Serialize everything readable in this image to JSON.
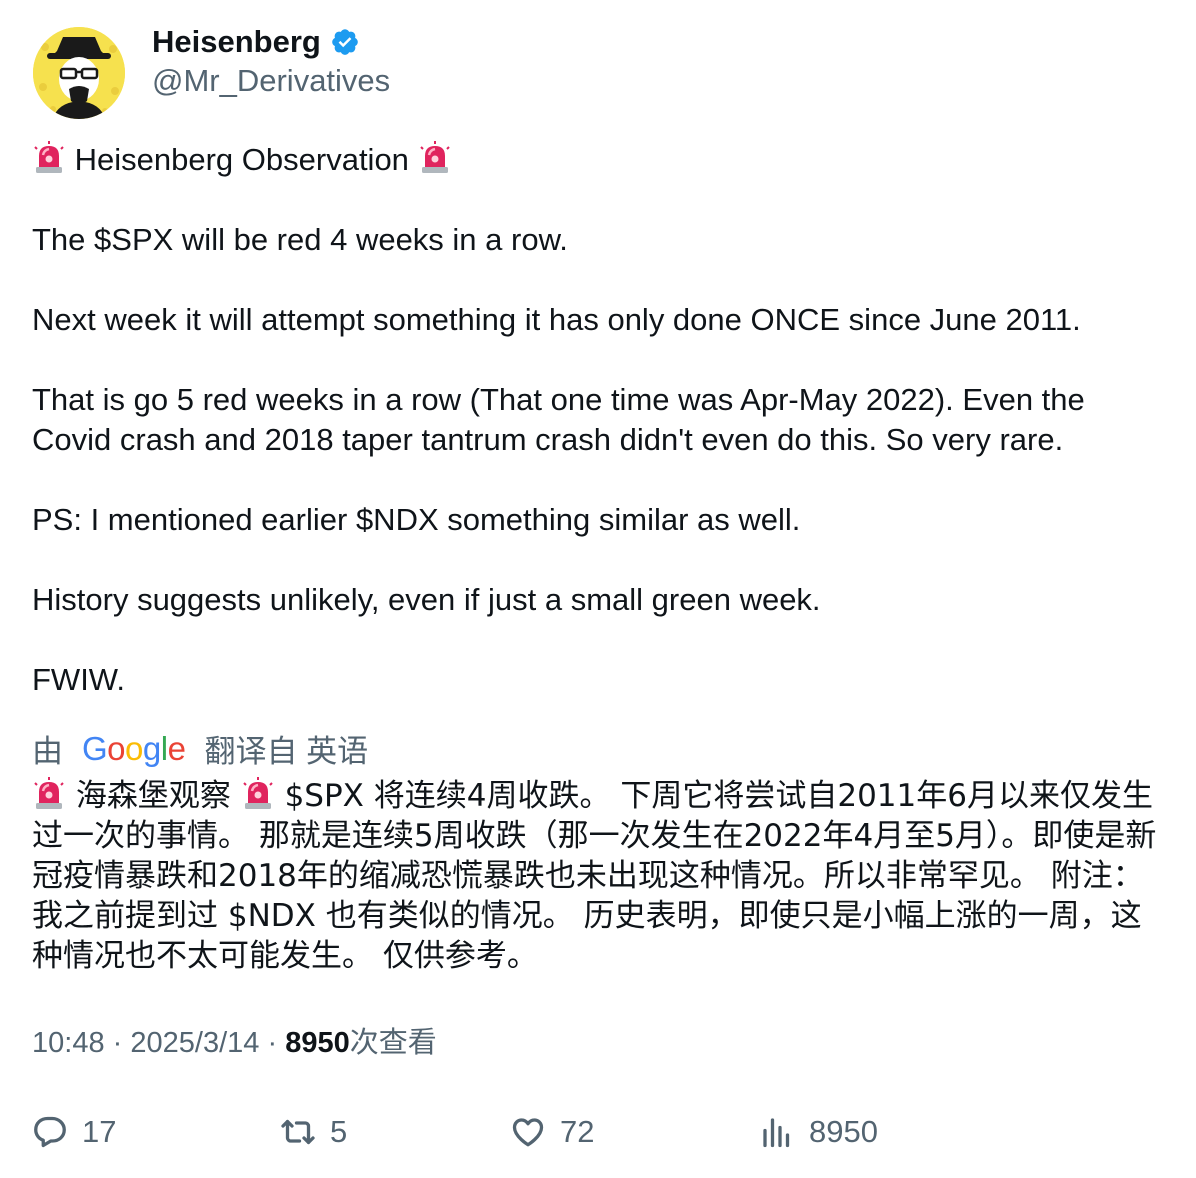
{
  "author": {
    "display_name": "Heisenberg",
    "handle": "@Mr_Derivatives",
    "verified": true,
    "avatar_icon": "heisenberg-avatar",
    "verified_color": "#1d9bf0"
  },
  "tweet": {
    "title_line": "Heisenberg Observation",
    "paragraphs": [
      "The $SPX will be red 4 weeks in a row.",
      "Next week it will attempt something it has only done ONCE since June 2011.",
      "That is go 5 red weeks in a row (That one time was Apr-May 2022). Even the Covid crash and 2018 taper tantrum crash didn't even do this. So very rare.",
      "PS: I mentioned earlier $NDX something similar as well.",
      "History suggests unlikely, even if just a small green week.",
      "FWIW."
    ],
    "siren_icon": "police-siren-emoji"
  },
  "translation": {
    "prefix": "由",
    "provider": "Google",
    "suffix": "翻译自 英语",
    "text_part1": "海森堡观察",
    "text_part2": "$SPX 将连续4周收跌。 下周它将尝试自2011年6月以来仅发生过一次的事情。 那就是连续5周收跌（那一次发生在2022年4月至5月）。即使是新冠疫情暴跌和2018年的缩减恐慌暴跌也未出现这种情况。所以非常罕见。 附注：我之前提到过 $NDX 也有类似的情况。 历史表明，即使只是小幅上涨的一周，这种情况也不太可能发生。 仅供参考。"
  },
  "meta": {
    "time": "10:48",
    "separator": "·",
    "date": "2025/3/14",
    "views_count": "8950",
    "views_label": "次查看"
  },
  "actions": {
    "replies": "17",
    "retweets": "5",
    "likes": "72",
    "views": "8950"
  },
  "colors": {
    "text_primary": "#0f1419",
    "text_secondary": "#536471",
    "verified_blue": "#1d9bf0",
    "siren_red": "#e0245e"
  }
}
